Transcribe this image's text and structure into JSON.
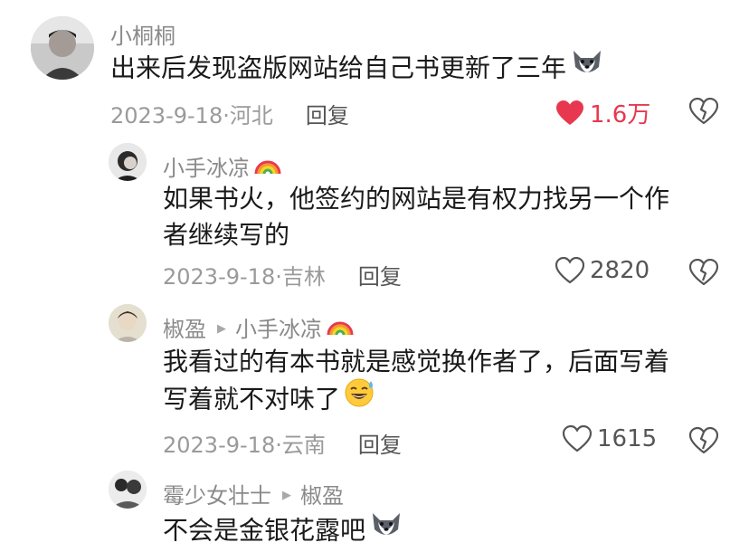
{
  "comments": [
    {
      "user": "小桐桐",
      "text": "出来后发现盗版网站给自己书更新了三年",
      "text_emoji": "husky-emoji",
      "date": "2023-9-18",
      "location": "河北",
      "reply_label": "回复",
      "likes": "1.6万",
      "liked": true
    },
    {
      "user": "小手冰凉",
      "user_emoji": "rainbow-emoji",
      "text_line1": "如果书火，他签约的网站是有权力找另一个作",
      "text_line2": "者继续写的",
      "date": "2023-9-18",
      "location": "吉林",
      "reply_label": "回复",
      "likes": "2820",
      "liked": false
    },
    {
      "user": "椒盈",
      "reply_to": "小手冰凉",
      "reply_to_emoji": "rainbow-emoji",
      "text_line1": "我看过的有本书就是感觉换作者了，后面写着",
      "text_line2": "写着就不对味了",
      "text_emoji": "sweat-smile-emoji",
      "date": "2023-9-18",
      "location": "云南",
      "reply_label": "回复",
      "likes": "1615",
      "liked": false
    },
    {
      "user": "霉少女壮士",
      "reply_to": "椒盈",
      "text": "不会是金银花露吧",
      "text_emoji": "husky-emoji"
    }
  ],
  "colors": {
    "like_active": "#e8384f",
    "username": "#8a8a8a",
    "meta": "#9a9a9a",
    "text": "#1a1a1a"
  }
}
